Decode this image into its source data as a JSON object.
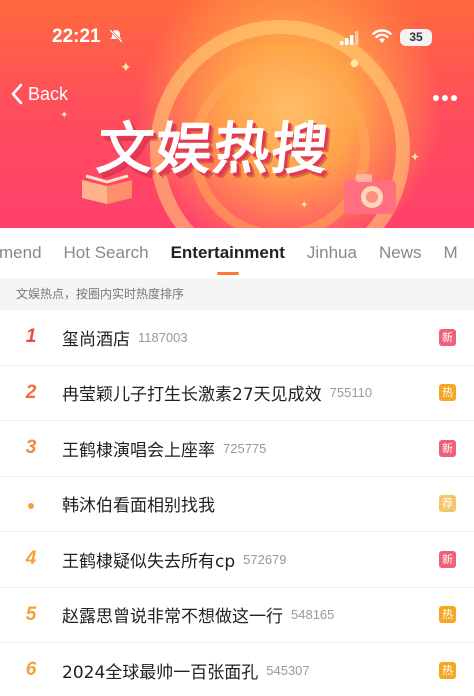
{
  "status_bar": {
    "time": "22:21",
    "battery": "35"
  },
  "header": {
    "back_label": "Back",
    "title": "文娱热搜"
  },
  "tabs": [
    {
      "label": "mend",
      "active": false
    },
    {
      "label": "Hot Search",
      "active": false
    },
    {
      "label": "Entertainment",
      "active": true
    },
    {
      "label": "Jinhua",
      "active": false
    },
    {
      "label": "News",
      "active": false
    },
    {
      "label": "M",
      "active": false
    }
  ],
  "subheader": "文娱热点，按圈内实时热度排序",
  "list": [
    {
      "rank": "1",
      "title": "玺尚酒店",
      "count": "1187003",
      "badge": "新",
      "badge_color": "#f0607a"
    },
    {
      "rank": "2",
      "title": "冉莹颖儿子打生长激素27天见成效",
      "count": "755110",
      "badge": "热",
      "badge_color": "#f5a623"
    },
    {
      "rank": "3",
      "title": "王鹤棣演唱会上座率",
      "count": "725775",
      "badge": "新",
      "badge_color": "#f0607a"
    },
    {
      "rank": "•",
      "title": "韩沐伯看面相别找我",
      "count": "",
      "badge": "荐",
      "badge_color": "#f5c56b"
    },
    {
      "rank": "4",
      "title": "王鹤棣疑似失去所有cp",
      "count": "572679",
      "badge": "新",
      "badge_color": "#f0607a"
    },
    {
      "rank": "5",
      "title": "赵露思曾说非常不想做这一行",
      "count": "548165",
      "badge": "热",
      "badge_color": "#f5a623"
    },
    {
      "rank": "6",
      "title": "2024全球最帅一百张面孔",
      "count": "545307",
      "badge": "热",
      "badge_color": "#f5a623"
    }
  ],
  "colors": {
    "accent": "#ff7a2a",
    "banner_top": "#ff6a3d",
    "banner_bottom": "#ff3f6c"
  }
}
